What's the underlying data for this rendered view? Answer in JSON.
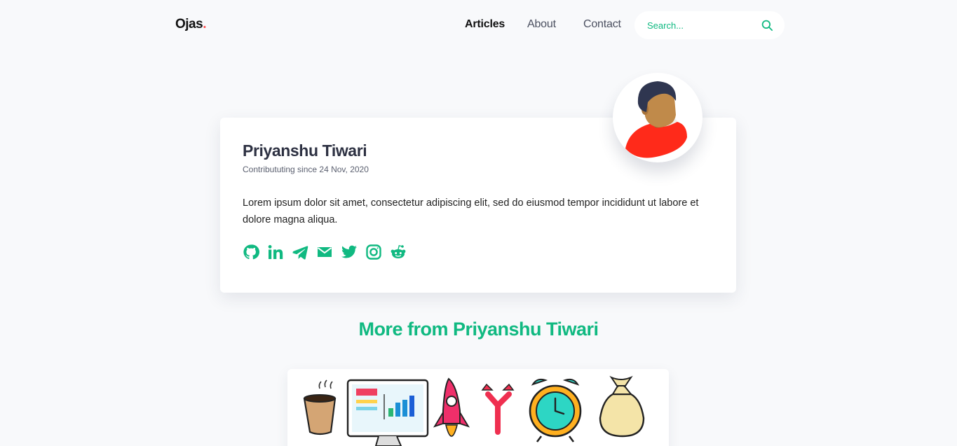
{
  "nav": {
    "logo": "Ojas",
    "logo_dot": ".",
    "links": [
      {
        "label": "Articles",
        "active": true
      },
      {
        "label": "About",
        "active": false
      },
      {
        "label": "Contact",
        "active": false
      }
    ],
    "search_placeholder": "Search..."
  },
  "profile": {
    "name": "Priyanshu Tiwari",
    "since": "Contribututing since 24 Nov, 2020",
    "bio": "Lorem ipsum dolor sit amet, consectetur adipiscing elit, sed do eiusmod tempor incididunt ut labore et dolore magna aliqua.",
    "socials": [
      "github-icon",
      "linkedin-icon",
      "telegram-icon",
      "mail-icon",
      "twitter-icon",
      "instagram-icon",
      "reddit-icon"
    ]
  },
  "more": {
    "title": "More from Priyanshu Tiwari"
  },
  "colors": {
    "accent": "#10b981",
    "background": "#f8f9fb",
    "logo_dot": "#ff4d4d",
    "avatar_shirt": "#ff2a1a"
  }
}
